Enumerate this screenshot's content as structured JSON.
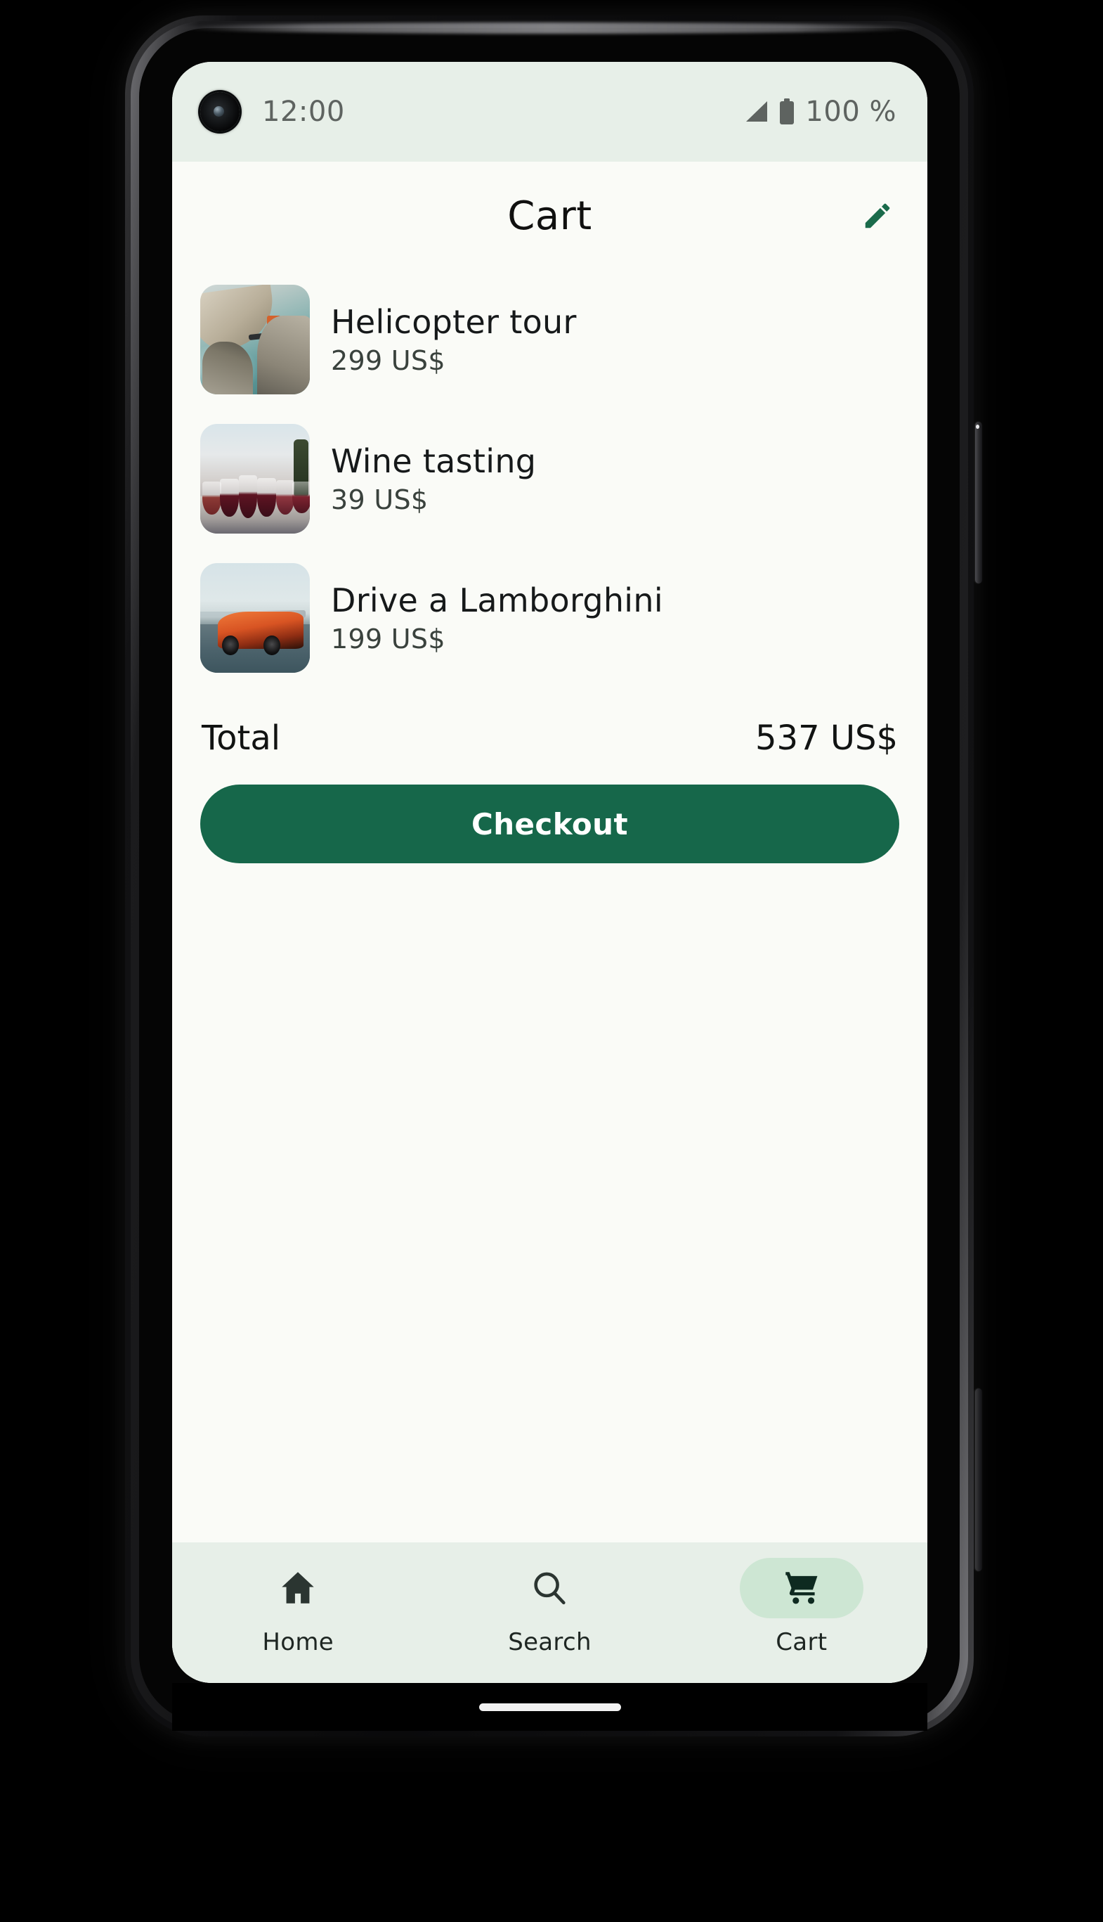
{
  "status_bar": {
    "time": "12:00",
    "battery_percent": "100 %",
    "signal_icon": "signal-bars-icon",
    "battery_icon": "battery-full-icon",
    "camera_icon": "front-camera-punch-hole",
    "background": "#E7EFE8"
  },
  "header": {
    "title": "Cart",
    "edit_icon": "pencil-edit-icon",
    "edit_icon_color": "#1A6B4B"
  },
  "cart": {
    "items": [
      {
        "name": "Helicopter tour",
        "price": "299 US$",
        "thumbnail": "helicopter-cockpit-photo"
      },
      {
        "name": "Wine tasting",
        "price": "39 US$",
        "thumbnail": "wine-glasses-photo"
      },
      {
        "name": "Drive a Lamborghini",
        "price": "199 US$",
        "thumbnail": "orange-lamborghini-photo"
      }
    ],
    "total_label": "Total",
    "total_value": "537 US$",
    "checkout_label": "Checkout",
    "checkout_color": "#16674A"
  },
  "bottom_nav": {
    "background": "#E7EFE8",
    "active_pill_color": "#CDE6D3",
    "items": [
      {
        "label": "Home",
        "icon": "home-icon",
        "active": false
      },
      {
        "label": "Search",
        "icon": "search-icon",
        "active": false
      },
      {
        "label": "Cart",
        "icon": "shopping-cart-icon",
        "active": true
      }
    ]
  },
  "device": {
    "power_button": "power-button",
    "volume_button": "volume-rocker-button",
    "home_indicator": "gesture-home-indicator"
  }
}
